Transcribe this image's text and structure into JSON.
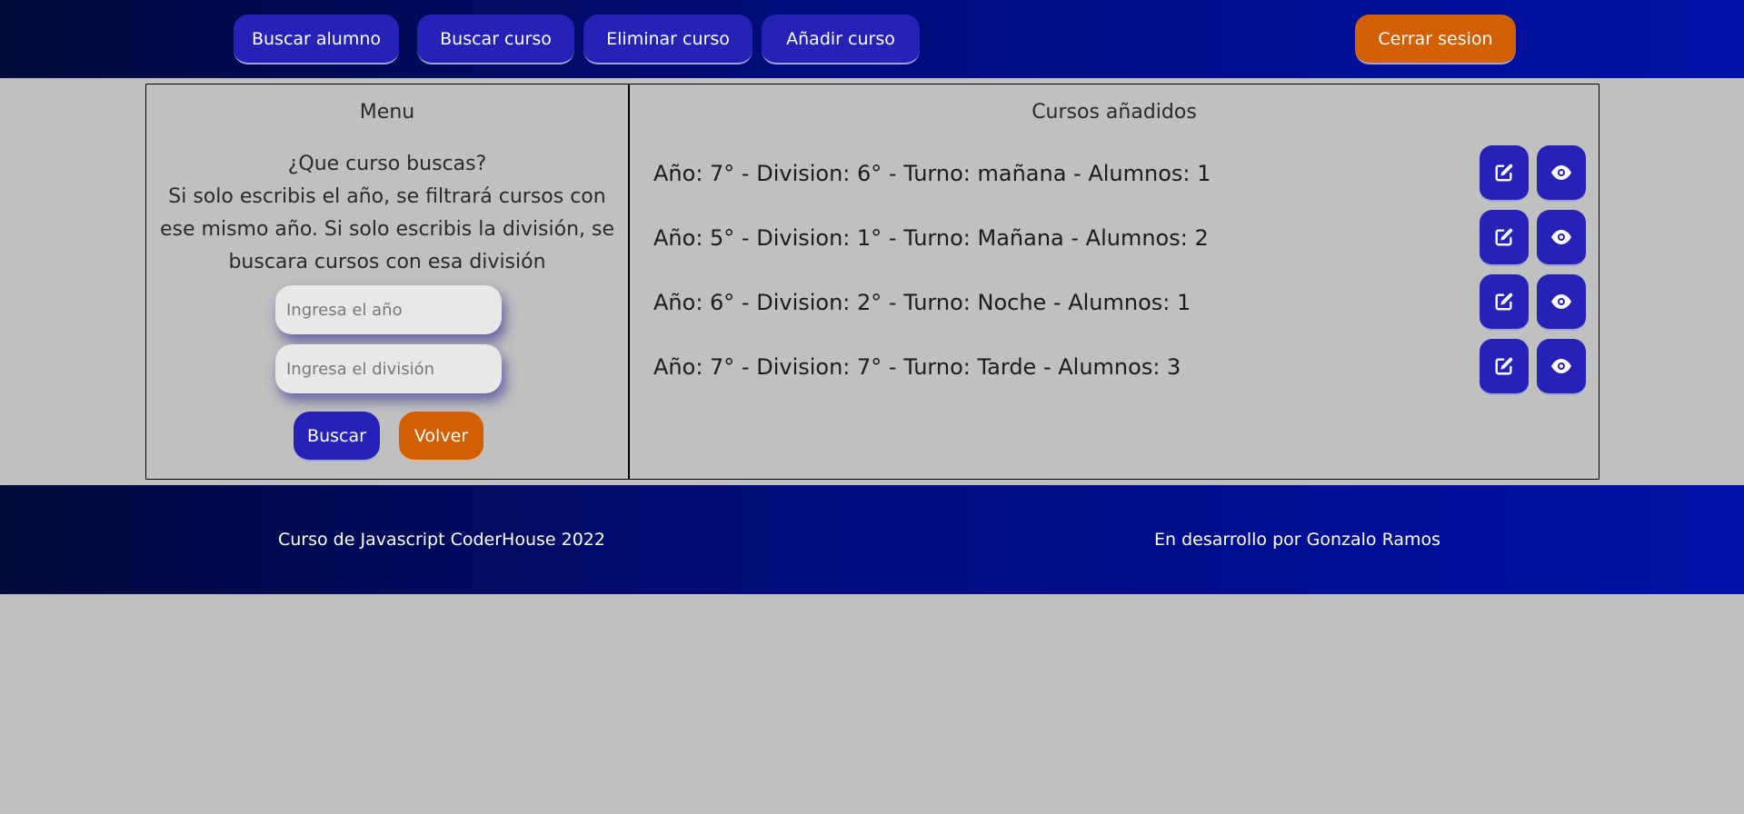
{
  "header": {
    "nav": [
      {
        "label": "Buscar alumno"
      },
      {
        "label": "Buscar curso"
      },
      {
        "label": "Eliminar curso"
      },
      {
        "label": "Añadir curso"
      }
    ],
    "logout_label": "Cerrar sesion"
  },
  "menu": {
    "title": "Menu",
    "question": "¿Que curso buscas?",
    "help": "Si solo escribis el año, se filtrará cursos con ese mismo año. Si solo escribis la división, se buscara cursos con esa división",
    "year_placeholder": "Ingresa el año",
    "division_placeholder": "Ingresa el división",
    "search_label": "Buscar",
    "back_label": "Volver"
  },
  "courses": {
    "title": "Cursos añadidos",
    "items": [
      {
        "text": "Año: 7° - Division: 6° - Turno: mañana - Alumnos: 1"
      },
      {
        "text": "Año: 5° - Division: 1° - Turno: Mañana - Alumnos: 2"
      },
      {
        "text": "Año: 6° - Division: 2° - Turno: Noche - Alumnos: 1"
      },
      {
        "text": "Año: 7° - Division: 7° - Turno: Tarde - Alumnos: 3"
      }
    ]
  },
  "footer": {
    "left": "Curso de Javascript CoderHouse 2022",
    "right": "En desarrollo por Gonzalo Ramos"
  },
  "icons": {
    "edit": "edit-icon",
    "view": "eye-icon"
  },
  "colors": {
    "primary": "#2622b7",
    "accent": "#d35f03",
    "header_start": "#000a3a",
    "header_end": "#0112a8",
    "background": "#c0c0c0"
  }
}
